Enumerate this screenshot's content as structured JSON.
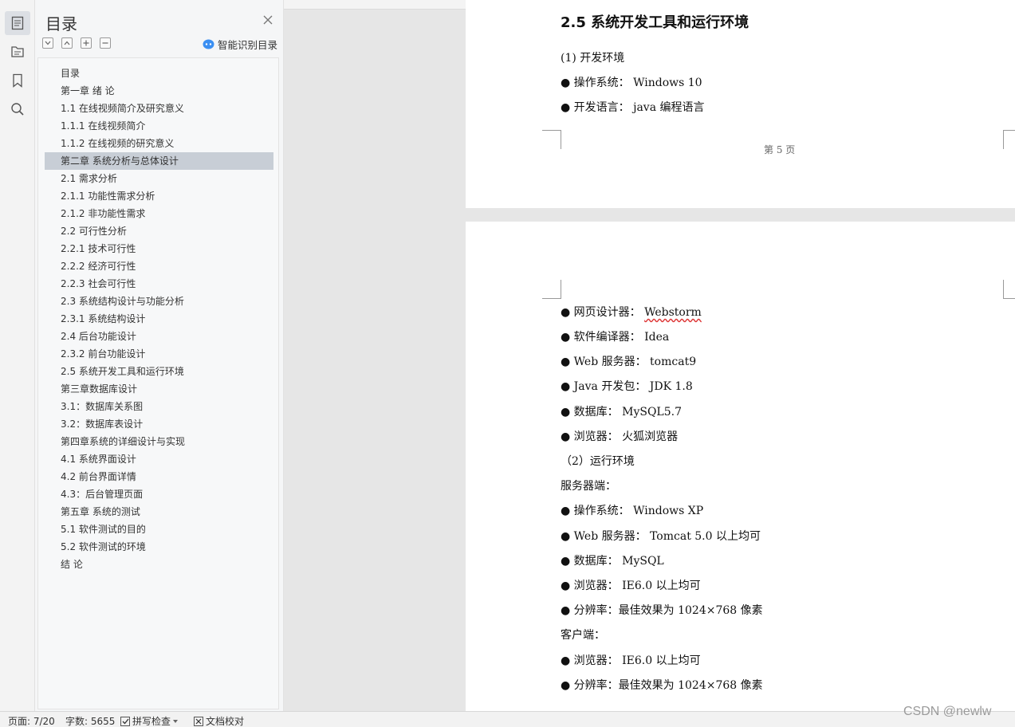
{
  "sidebar_panel": {
    "title": "目录",
    "smart_toc_label": "智能识别目录",
    "items": [
      {
        "label": "目录",
        "selected": false
      },
      {
        "label": "第一章 绪 论",
        "selected": false
      },
      {
        "label": "1.1 在线视频简介及研究意义",
        "selected": false
      },
      {
        "label": "1.1.1 在线视频简介",
        "selected": false
      },
      {
        "label": "1.1.2 在线视频的研究意义",
        "selected": false
      },
      {
        "label": "第二章 系统分析与总体设计",
        "selected": true
      },
      {
        "label": "2.1 需求分析",
        "selected": false
      },
      {
        "label": "2.1.1 功能性需求分析",
        "selected": false
      },
      {
        "label": "2.1.2 非功能性需求",
        "selected": false
      },
      {
        "label": "2.2 可行性分析",
        "selected": false
      },
      {
        "label": "2.2.1 技术可行性",
        "selected": false
      },
      {
        "label": "2.2.2 经济可行性",
        "selected": false
      },
      {
        "label": "2.2.3 社会可行性",
        "selected": false
      },
      {
        "label": "2.3 系统结构设计与功能分析",
        "selected": false
      },
      {
        "label": "2.3.1 系统结构设计",
        "selected": false
      },
      {
        "label": "2.4 后台功能设计",
        "selected": false
      },
      {
        "label": "2.3.2 前台功能设计",
        "selected": false
      },
      {
        "label": "2.5 系统开发工具和运行环境",
        "selected": false
      },
      {
        "label": "第三章数据库设计",
        "selected": false
      },
      {
        "label": "3.1：数据库关系图",
        "selected": false
      },
      {
        "label": "3.2：数据库表设计",
        "selected": false
      },
      {
        "label": "第四章系统的详细设计与实现",
        "selected": false
      },
      {
        "label": "4.1 系统界面设计",
        "selected": false
      },
      {
        "label": "4.2 前台界面详情",
        "selected": false
      },
      {
        "label": "4.3：后台管理页面",
        "selected": false
      },
      {
        "label": "第五章 系统的测试",
        "selected": false
      },
      {
        "label": "5.1 软件测试的目的",
        "selected": false
      },
      {
        "label": "5.2 软件测试的环境",
        "selected": false
      },
      {
        "label": "结 论",
        "selected": false
      }
    ]
  },
  "page1": {
    "heading": "2.5  系统开发工具和运行环境",
    "lines": [
      "(1) 开发环境",
      "● 操作系统： Windows 10",
      "● 开发语言： java 编程语言"
    ],
    "page_number": "第 5 页"
  },
  "page2": {
    "webstorm_prefix": "● 网页设计器： ",
    "webstorm_word": "Webstorm",
    "lines": [
      "● 软件编译器： Idea",
      "● Web 服务器： tomcat9",
      "● Java 开发包： JDK 1.8",
      "● 数据库： MySQL5.7",
      "● 浏览器： 火狐浏览器",
      "（2）运行环境",
      "服务器端：",
      "● 操作系统： Windows XP",
      "● Web 服务器： Tomcat 5.0 以上均可",
      "● 数据库： MySQL",
      "● 浏览器： IE6.0 以上均可",
      "● 分辨率：最佳效果为 1024×768 像素",
      "客户端：",
      "● 浏览器： IE6.0 以上均可",
      "● 分辨率：最佳效果为 1024×768 像素"
    ]
  },
  "statusbar": {
    "page": "页面: 7/20",
    "wordcount": "字数: 5655",
    "spellcheck": "拼写检查",
    "doccheck": "文档校对"
  },
  "watermark": "CSDN @newlw"
}
